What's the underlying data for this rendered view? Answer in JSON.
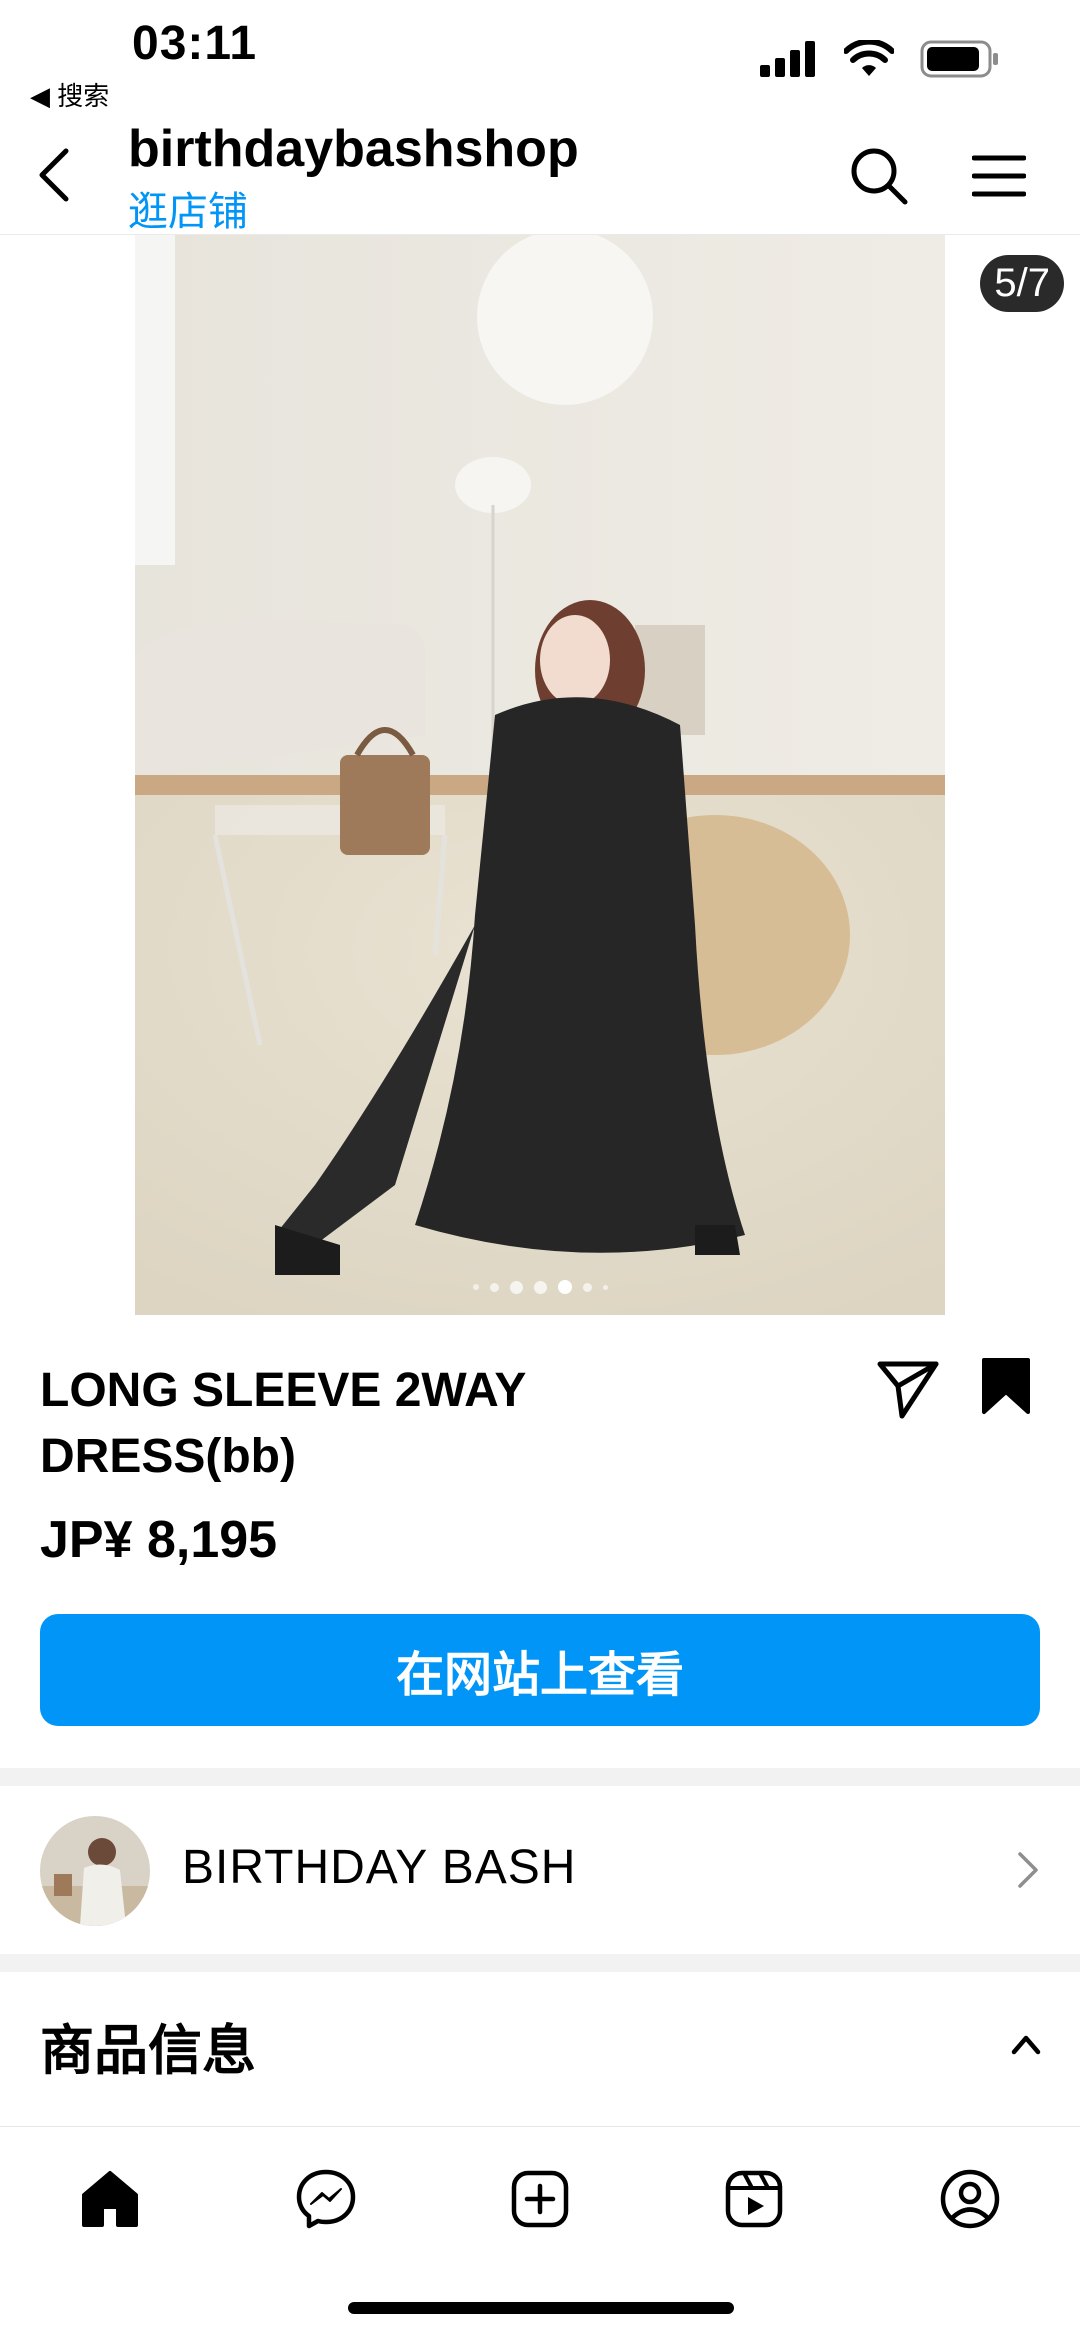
{
  "status_bar": {
    "time": "03:11",
    "back_app": "◀ 搜索"
  },
  "header": {
    "title": "birthdaybashshop",
    "subtitle": "逛店铺"
  },
  "media": {
    "counter": "5/7",
    "dot_count": 7,
    "active_dot": 4
  },
  "product": {
    "name": "LONG SLEEVE 2WAY DRESS(bb)",
    "price": "JP¥ 8,195",
    "cta_label": "在网站上查看"
  },
  "seller": {
    "name": "BIRTHDAY BASH"
  },
  "info_section": {
    "title": "商品信息"
  },
  "icons": {
    "back": "chevron-left-icon",
    "search": "search-icon",
    "menu": "hamburger-menu-icon",
    "share": "send-icon",
    "save": "bookmark-icon",
    "nav": [
      "home-icon",
      "messenger-icon",
      "create-icon",
      "reels-icon",
      "profile-icon"
    ]
  },
  "colors": {
    "accent": "#0095f6",
    "text": "#000000"
  }
}
